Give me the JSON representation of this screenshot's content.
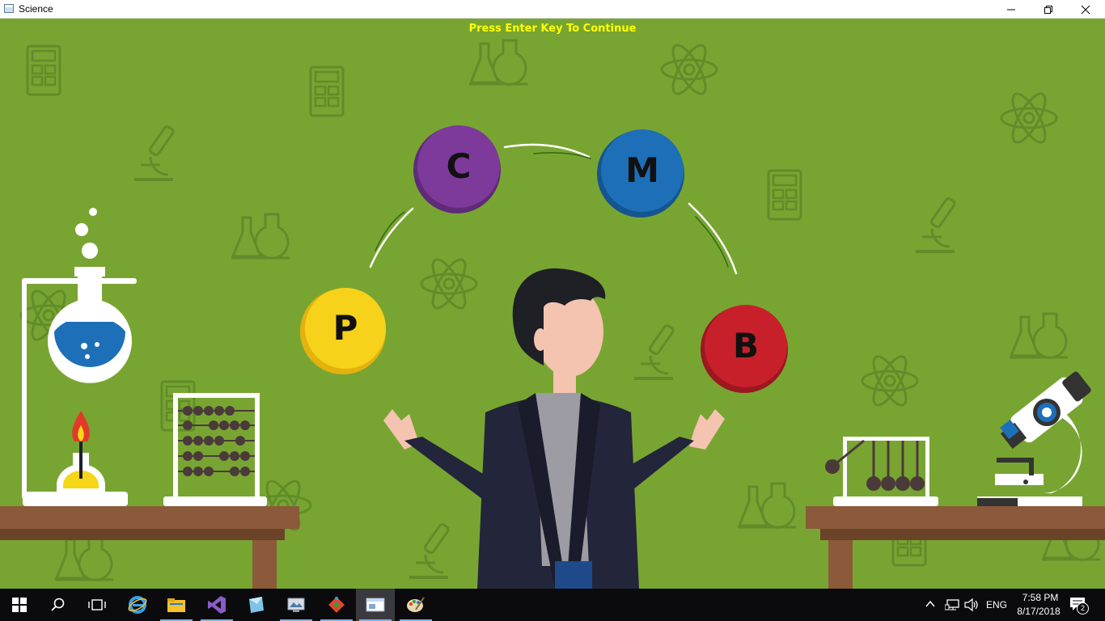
{
  "window": {
    "title": "Science"
  },
  "scene": {
    "prompt": "Press Enter Key To Continue",
    "balls": [
      {
        "letter": "P",
        "color": "#f7d21b"
      },
      {
        "letter": "C",
        "color": "#7d3a9b"
      },
      {
        "letter": "M",
        "color": "#1d6fb8"
      },
      {
        "letter": "B",
        "color": "#c8202a"
      }
    ]
  },
  "taskbar": {
    "apps": [
      "start-icon",
      "search-icon",
      "task-view-icon",
      "internet-explorer-icon",
      "file-explorer-icon",
      "visual-studio-icon",
      "app-icon-1",
      "app-icon-2",
      "app-icon-3",
      "science-app-icon",
      "paint-icon"
    ],
    "language": "ENG",
    "time": "7:58 PM",
    "date": "8/17/2018",
    "notifications": "2"
  },
  "colors": {
    "background": "#78a531",
    "prompt": "#ffff00",
    "taskbar": "#0b0b0d"
  }
}
